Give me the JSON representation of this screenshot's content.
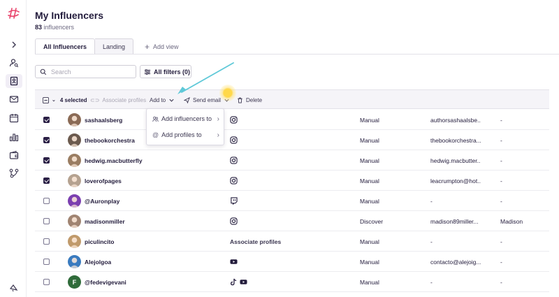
{
  "header": {
    "title": "My Influencers",
    "count": "83",
    "count_suffix": "influencers"
  },
  "tabs": [
    {
      "label": "All Influencers",
      "active": true
    },
    {
      "label": "Landing",
      "active": false
    }
  ],
  "add_view_label": "Add view",
  "search": {
    "placeholder": "Search"
  },
  "filters_label": "All filters (0)",
  "toolbar": {
    "selected_label": "4 selected",
    "associate_label": "Associate profiles",
    "add_to_label": "Add to",
    "send_email_label": "Send email",
    "delete_label": "Delete"
  },
  "dropdown": {
    "items": [
      {
        "label": "Add influencers to",
        "icon": "users-icon"
      },
      {
        "label": "Add profiles to",
        "icon": "at-icon"
      }
    ]
  },
  "rows": [
    {
      "username": "sashaalsberg",
      "checked": true,
      "platform": "instagram",
      "source": "Manual",
      "email": "authorsashaalsbe...",
      "name": "-",
      "avatar_color": "#8a6a55"
    },
    {
      "username": "thebookorchestra",
      "checked": true,
      "platform": "instagram",
      "source": "Manual",
      "email": "thebookorchestra...",
      "name": "-",
      "avatar_color": "#6b5a4e"
    },
    {
      "username": "hedwig.macbutterfly",
      "checked": true,
      "platform": "instagram",
      "source": "Manual",
      "email": "hedwig.macbutter...",
      "name": "-",
      "avatar_color": "#9a7d62"
    },
    {
      "username": "loverofpages",
      "checked": true,
      "platform": "instagram",
      "source": "Manual",
      "email": "leacrumpton@hot...",
      "name": "-",
      "avatar_color": "#b5a290"
    },
    {
      "username": "@Auronplay",
      "checked": false,
      "platform": "twitch",
      "source": "Manual",
      "email": "-",
      "name": "-",
      "avatar_color": "#7b3fb0"
    },
    {
      "username": "madisonmiller",
      "checked": false,
      "platform": "instagram",
      "source": "Discover",
      "email": "madison89miller...",
      "name": "Madison",
      "avatar_color": "#a08472"
    },
    {
      "username": "piculincito",
      "checked": false,
      "platform": "Associate profiles",
      "source": "Manual",
      "email": "-",
      "name": "-",
      "avatar_color": "#c09a6b"
    },
    {
      "username": "Alejolgoa",
      "checked": false,
      "platform": "youtube",
      "source": "Manual",
      "email": "contacto@alejoig...",
      "name": "-",
      "avatar_color": "#3a7bbf"
    },
    {
      "username": "@fedevigevani",
      "checked": false,
      "platform": "tiktok-youtube",
      "source": "Manual",
      "email": "-",
      "name": "-",
      "avatar_letter": "F",
      "avatar_color": "#2f6b3a"
    }
  ],
  "colors": {
    "accent": "#e8436b",
    "dark": "#231c3c",
    "checkbox": "#2a1f45",
    "arrow": "#5fc9d8"
  }
}
